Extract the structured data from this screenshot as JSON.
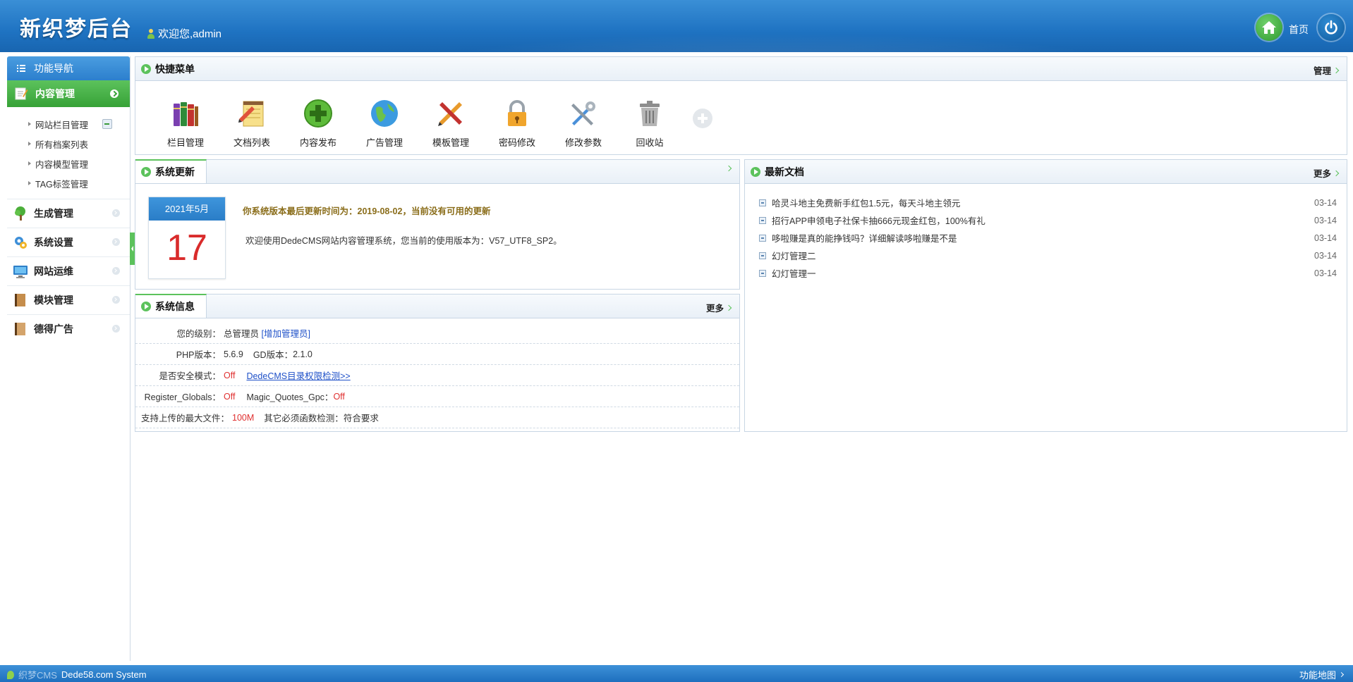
{
  "header": {
    "logo": "新织梦后台",
    "welcome": "欢迎您,admin",
    "home_label": "首页",
    "home_icon": "home-icon",
    "power_icon": "power-icon"
  },
  "sidebar": {
    "nav_title": "功能导航",
    "active_section": "内容管理",
    "sub_items": [
      "网站栏目管理",
      "所有档案列表",
      "内容模型管理",
      "TAG标签管理"
    ],
    "sections": [
      "生成管理",
      "系统设置",
      "网站运维",
      "模块管理",
      "德得广告"
    ]
  },
  "quick_menu": {
    "title": "快捷菜单",
    "manage_label": "管理",
    "items": [
      "栏目管理",
      "文档列表",
      "内容发布",
      "广告管理",
      "模板管理",
      "密码修改",
      "修改参数",
      "回收站"
    ]
  },
  "system_update": {
    "title": "系统更新",
    "calendar_month": "2021年5月",
    "calendar_day": "17",
    "line1": "你系统版本最后更新时间为：2019-08-02，当前没有可用的更新",
    "line2": "欢迎使用DedeCMS网站内容管理系统，您当前的使用版本为：V57_UTF8_SP2。"
  },
  "system_info": {
    "title": "系统信息",
    "more_label": "更多",
    "level_label": "您的级别：",
    "level_value": "总管理员",
    "add_admin": "[增加管理员]",
    "php_label": "PHP版本：",
    "php_value": "5.6.9",
    "gd_label": "GD版本：",
    "gd_value": "2.1.0",
    "safe_label": "是否安全模式：",
    "safe_value": "Off",
    "dir_check": "DedeCMS目录权限检测>>",
    "rg_label": "Register_Globals：",
    "rg_value": "Off",
    "mq_label": "Magic_Quotes_Gpc：",
    "mq_value": "Off",
    "upload_label": "支持上传的最大文件：",
    "upload_value": "100M",
    "func_label": "其它必须函数检测：",
    "func_value": "符合要求"
  },
  "latest_docs": {
    "title": "最新文档",
    "more_label": "更多",
    "items": [
      {
        "title": "哈灵斗地主免费新手红包1.5元，每天斗地主领元",
        "date": "03-14"
      },
      {
        "title": "招行APP申领电子社保卡抽666元现金红包，100%有礼",
        "date": "03-14"
      },
      {
        "title": "哆啦赚是真的能挣钱吗？详细解读哆啦赚是不是",
        "date": "03-14"
      },
      {
        "title": "幻灯管理二",
        "date": "03-14"
      },
      {
        "title": "幻灯管理一",
        "date": "03-14"
      }
    ]
  },
  "footer": {
    "brand": "织梦CMS",
    "system": "Dede58.com System",
    "sitemap": "功能地图"
  }
}
